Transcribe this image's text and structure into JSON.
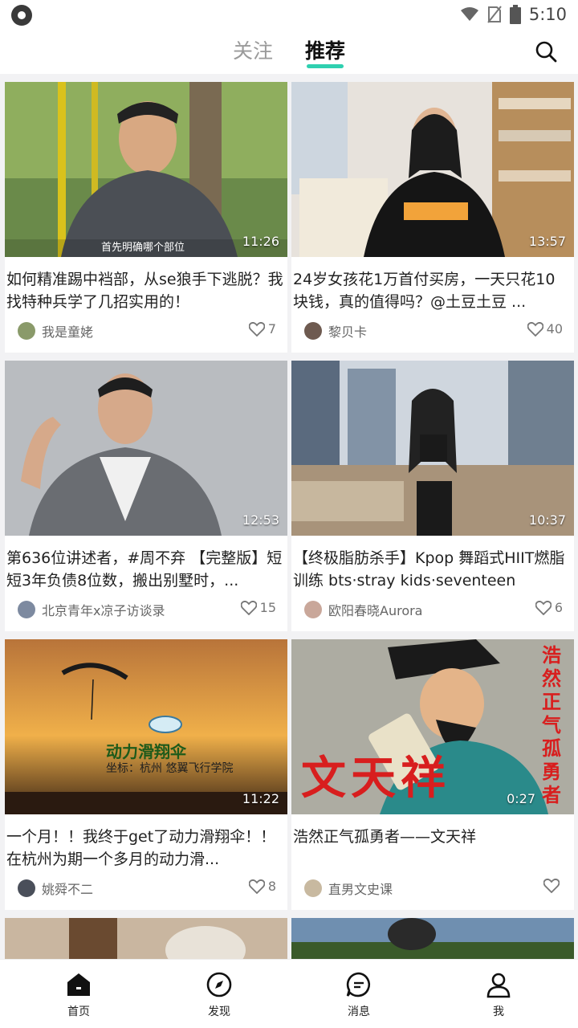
{
  "statusbar": {
    "time": "5:10",
    "icons": [
      "wifi-icon",
      "sim-icon",
      "battery-icon"
    ]
  },
  "header": {
    "tabs": [
      {
        "label": "关注",
        "active": false
      },
      {
        "label": "推荐",
        "active": true
      }
    ],
    "accent_color": "#2fd0b0"
  },
  "feed": {
    "cards": [
      {
        "duration": "11:26",
        "subtitle_overlay": "首先明确哪个部位",
        "title": "如何精准踢中裆部，从se狼手下逃脱？我找特种兵学了几招实用的！",
        "author": "我是童姥",
        "likes": "7"
      },
      {
        "duration": "13:57",
        "title": "24岁女孩花1万首付买房，一天只花10块钱，真的值得吗？@土豆土豆 ...",
        "author": "黎贝卡",
        "likes": "40"
      },
      {
        "duration": "12:53",
        "title": "第636位讲述者，#周不弃 【完整版】短短3年负债8位数，搬出别墅时，...",
        "author": "北京青年x凉子访谈录",
        "likes": "15"
      },
      {
        "duration": "10:37",
        "title": "【终极脂肪杀手】Kpop 舞蹈式HIIT燃脂训练 bts·stray kids·seventeen",
        "author": "欧阳春晓Aurora",
        "likes": "6"
      },
      {
        "duration": "11:22",
        "overlay_text": "动力滑翔伞",
        "overlay_sub": "坐标：杭州 悠翼飞行学院",
        "title": "一个月！！我终于get了动力滑翔伞！！在杭州为期一个多月的动力滑...",
        "author": "姚舜不二",
        "likes": "8"
      },
      {
        "duration": "0:27",
        "overlay_big": "文天祥",
        "overlay_vertical": "浩然正气孤勇者",
        "title": "浩然正气孤勇者——文天祥",
        "author": "直男文史课",
        "likes": ""
      }
    ]
  },
  "bottomnav": {
    "items": [
      {
        "label": "首页"
      },
      {
        "label": "发现"
      },
      {
        "label": "消息"
      },
      {
        "label": "我"
      }
    ]
  }
}
